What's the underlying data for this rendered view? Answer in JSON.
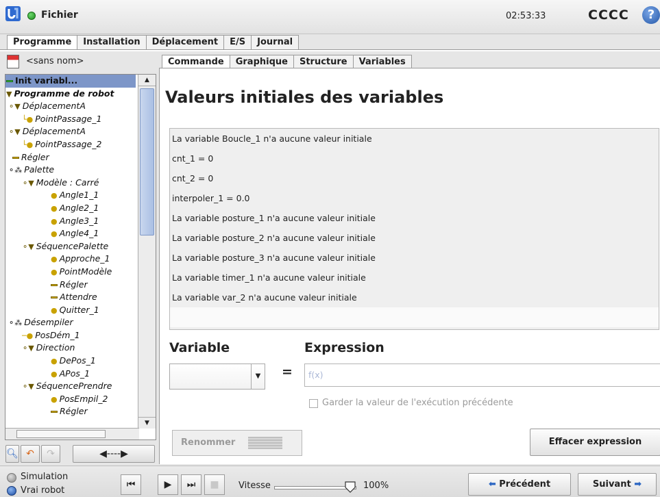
{
  "titlebar": {
    "menu": "Fichier",
    "clock": "02:53:33",
    "robot_name": "CCCC",
    "help": "?"
  },
  "main_tabs": [
    "Programme",
    "Installation",
    "Déplacement",
    "E/S",
    "Journal"
  ],
  "program": {
    "file_name": "<sans nom>"
  },
  "tree": {
    "items": [
      "Init variabl...",
      "Programme de robot",
      "DéplacementA",
      "PointPassage_1",
      "DéplacementA",
      "PointPassage_2",
      "Régler",
      "Palette",
      "Modèle : Carré",
      "Angle1_1",
      "Angle2_1",
      "Angle3_1",
      "Angle4_1",
      "SéquencePalette",
      "Approche_1",
      "PointModèle",
      "Régler",
      "Attendre",
      "Quitter_1",
      "Désempiler",
      "PosDém_1",
      "Direction",
      "DePos_1",
      "APos_1",
      "SéquencePrendre",
      "PosEmpil_2",
      "Régler"
    ]
  },
  "sub_tabs": [
    "Commande",
    "Graphique",
    "Structure",
    "Variables"
  ],
  "panel": {
    "title": "Valeurs initiales des variables",
    "variables": [
      "La variable Boucle_1 n'a aucune valeur initiale",
      "cnt_1 = 0",
      "cnt_2 = 0",
      "interpoler_1 = 0.0",
      "La variable posture_1 n'a aucune valeur initiale",
      "La variable posture_2 n'a aucune valeur initiale",
      "La variable posture_3 n'a aucune valeur initiale",
      "La variable timer_1 n'a aucune valeur initiale",
      "La variable var_2 n'a aucune valeur initiale"
    ],
    "variable_label": "Variable",
    "expression_label": "Expression",
    "equals": "=",
    "expression_placeholder": "f(x)",
    "keep_label": "Garder la valeur de l'exécution précédente",
    "rename_label": "Renommer",
    "clear_label": "Effacer expression"
  },
  "footer": {
    "simulation": "Simulation",
    "real_robot": "Vrai robot",
    "speed_label": "Vitesse",
    "speed_value": "100%",
    "speed_fraction": 1.0,
    "prev_label": "Précédent",
    "next_label": "Suivant"
  },
  "colors": {
    "selection": "#7d96c8",
    "accent_blue": "#2a65c2",
    "run_green": "#1e8f1e"
  }
}
